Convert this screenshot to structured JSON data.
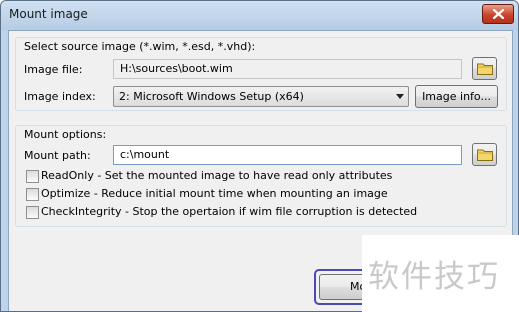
{
  "window": {
    "title": "Mount image"
  },
  "source_group": {
    "label": "Select source image (*.wim, *.esd, *.vhd):",
    "image_file_label": "Image file:",
    "image_file_value": "H:\\sources\\boot.wim",
    "image_index_label": "Image index:",
    "image_index_value": "2:  Microsoft Windows Setup (x64)",
    "image_info_button": "Image info..."
  },
  "mount_group": {
    "label": "Mount options:",
    "mount_path_label": "Mount path:",
    "mount_path_value": "c:\\mount",
    "options": [
      {
        "label": "ReadOnly - Set the mounted image to have read only attributes",
        "checked": false
      },
      {
        "label": "Optimize - Reduce initial mount time when mounting an image",
        "checked": false
      },
      {
        "label": "CheckIntegrity - Stop the opertaion if wim file corruption is detected",
        "checked": false
      }
    ]
  },
  "footer": {
    "mount_button_partial": "Mo"
  },
  "watermark": {
    "text": "软件技巧"
  },
  "icons": [
    "close-icon",
    "folder-icon",
    "chevron-down-icon"
  ],
  "colors": {
    "titlebar": "#bcd3ea",
    "client": "#f0f0f0",
    "close": "#c9452c",
    "focus_ring": "#4a4ab0"
  }
}
